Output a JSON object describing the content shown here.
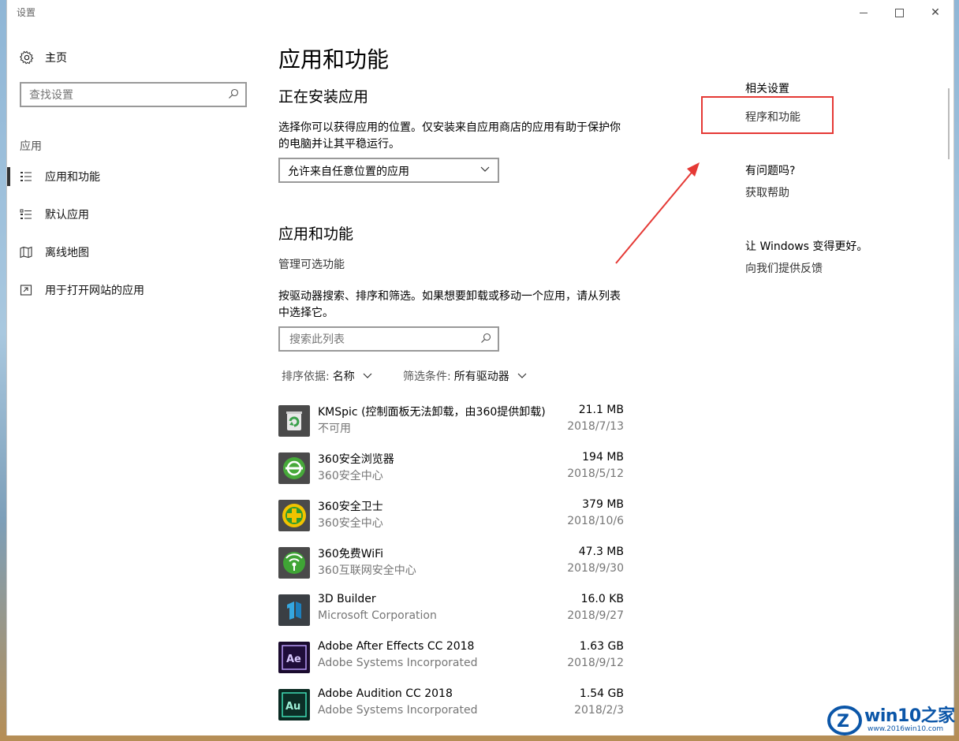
{
  "window": {
    "title": "设置",
    "controls": {
      "minimize": "minimize",
      "maximize": "maximize",
      "close": "✕"
    }
  },
  "sidebar": {
    "home": "主页",
    "search_placeholder": "查找设置",
    "section": "应用",
    "items": [
      {
        "label": "应用和功能",
        "icon": "apps-features-icon",
        "active": true
      },
      {
        "label": "默认应用",
        "icon": "default-apps-icon",
        "active": false
      },
      {
        "label": "离线地图",
        "icon": "offline-maps-icon",
        "active": false
      },
      {
        "label": "用于打开网站的应用",
        "icon": "apps-for-websites-icon",
        "active": false
      }
    ]
  },
  "main": {
    "title": "应用和功能",
    "install_heading": "正在安装应用",
    "install_desc": "选择你可以获得应用的位置。仅安装来自应用商店的应用有助于保护你的电脑并让其平稳运行。",
    "install_select": "允许来自任意位置的应用",
    "apps_heading": "应用和功能",
    "manage_optional": "管理可选功能",
    "apps_desc": "按驱动器搜索、排序和筛选。如果想要卸载或移动一个应用，请从列表中选择它。",
    "list_search_placeholder": "搜索此列表",
    "sort_label": "排序依据:",
    "sort_value": "名称",
    "filter_label": "筛选条件:",
    "filter_value": "所有驱动器",
    "apps": [
      {
        "name": " KMSpic (控制面板无法卸载，由360提供卸载)",
        "publisher": "不可用",
        "size": "21.1 MB",
        "date": "2018/7/13",
        "icon": "recycle-bin-icon"
      },
      {
        "name": "360安全浏览器",
        "publisher": "360安全中心",
        "size": "194 MB",
        "date": "2018/5/12",
        "icon": "360-browser-icon"
      },
      {
        "name": "360安全卫士",
        "publisher": "360安全中心",
        "size": "379 MB",
        "date": "2018/10/6",
        "icon": "360-security-icon"
      },
      {
        "name": "360免费WiFi",
        "publisher": "360互联网安全中心",
        "size": "47.3 MB",
        "date": "2018/9/30",
        "icon": "360-wifi-icon"
      },
      {
        "name": "3D Builder",
        "publisher": "Microsoft Corporation",
        "size": "16.0 KB",
        "date": "2018/9/27",
        "icon": "3d-builder-icon"
      },
      {
        "name": "Adobe After Effects CC 2018",
        "publisher": "Adobe Systems Incorporated",
        "size": "1.63 GB",
        "date": "2018/9/12",
        "icon": "after-effects-icon"
      },
      {
        "name": "Adobe Audition CC 2018",
        "publisher": "Adobe Systems Incorporated",
        "size": "1.54 GB",
        "date": "2018/2/3",
        "icon": "audition-icon"
      }
    ]
  },
  "related": {
    "heading": "相关设置",
    "programs_link": "程序和功能",
    "question_heading": "有问题吗?",
    "help_link": "获取帮助",
    "improve_heading": "让 Windows 变得更好。",
    "feedback_link": "向我们提供反馈"
  },
  "colors": {
    "highlight": "#e53935",
    "watermark": "#0b56a8"
  },
  "watermark": {
    "brand": "win10之家",
    "url": "www.2016win10.com"
  }
}
